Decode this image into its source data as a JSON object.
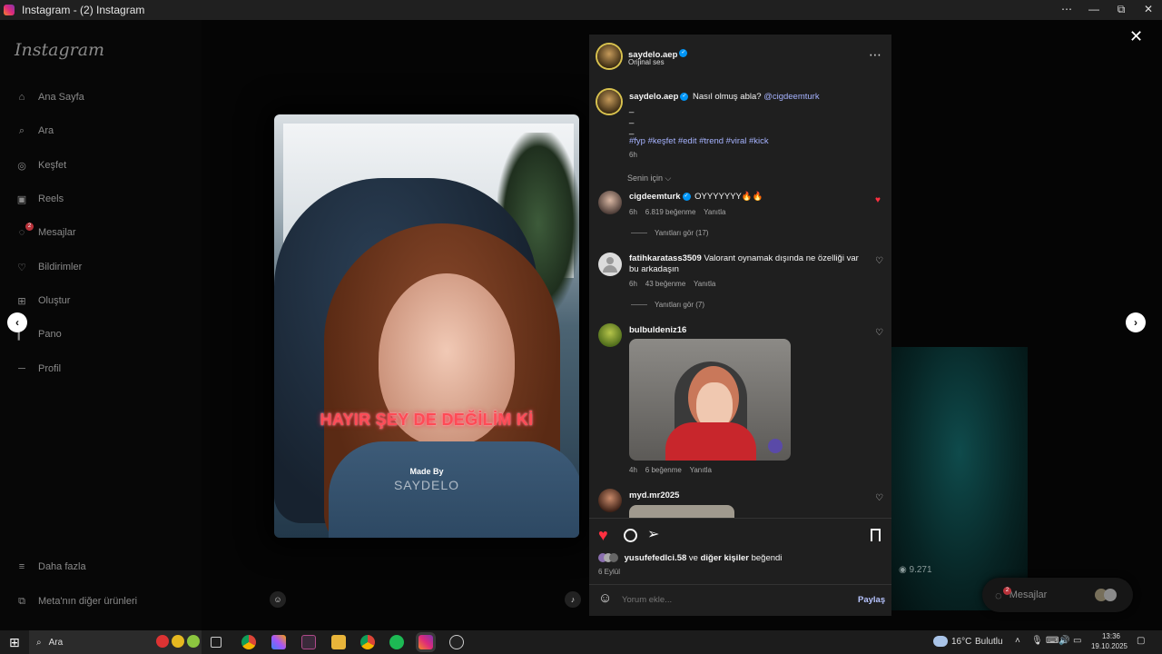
{
  "window": {
    "title": "Instagram - (2) Instagram",
    "min": "—",
    "max": "⧉",
    "close": "✕",
    "more": "⋯"
  },
  "sidebar": {
    "logo": "Instagram",
    "items": [
      {
        "label": "Ana Sayfa",
        "icon": "home-icon",
        "glyph": "⌂"
      },
      {
        "label": "Ara",
        "icon": "search-icon",
        "glyph": "⌕"
      },
      {
        "label": "Keşfet",
        "icon": "compass-icon",
        "glyph": "◎"
      },
      {
        "label": "Reels",
        "icon": "reels-icon",
        "glyph": "▣"
      },
      {
        "label": "Mesajlar",
        "icon": "messenger-icon",
        "glyph": "◌",
        "badge": "2"
      },
      {
        "label": "Bildirimler",
        "icon": "heart-icon",
        "glyph": "♡"
      },
      {
        "label": "Oluştur",
        "icon": "plus-square-icon",
        "glyph": "⊞"
      },
      {
        "label": "Pano",
        "icon": "dashboard-icon",
        "glyph": "▎"
      },
      {
        "label": "Profil",
        "icon": "profile-icon",
        "glyph": "─"
      }
    ],
    "more": {
      "label": "Daha fazla",
      "glyph": "≡"
    },
    "meta": {
      "label": "Meta'nın diğer ürünleri",
      "glyph": "⧉"
    }
  },
  "video": {
    "caption": "HAYIR ŞEY DE DEĞİLİM Kİ",
    "madeby": "Made By",
    "watermark": "SAYDELO",
    "user_icon": "☺",
    "sound_icon": "♪"
  },
  "post": {
    "header": {
      "username": "saydelo.aep",
      "audio": "Orijinal ses",
      "more": "⋯"
    },
    "caption": {
      "username": "saydelo.aep",
      "text": "Nasıl olmuş abla?",
      "mention": "@cigdeemturk",
      "dots": [
        "_",
        "_",
        "_"
      ],
      "hashtags": "#fyp #keşfet #edit #trend #viral #kick",
      "time": "6h"
    },
    "sort": "Senin için ⌵",
    "comments": [
      {
        "username": "cigdeemturk",
        "verified": true,
        "text": "OYYYYYYY🔥🔥",
        "time": "6h",
        "likes": "6.819 beğenme",
        "reply": "Yanıtla",
        "replies": "Yanıtları gör (17)",
        "liked": true
      },
      {
        "username": "fatihkaratass3509",
        "text": "Valorant oynamak dışında ne özelliği var bu arkadaşın",
        "time": "6h",
        "likes": "43 beğenme",
        "reply": "Yanıtla",
        "replies": "Yanıtları gör (7)"
      },
      {
        "username": "bulbuldeniz16",
        "text": "",
        "time": "4h",
        "likes": "6 beğenme",
        "reply": "Yanıtla"
      },
      {
        "username": "myd.mr2025",
        "text": ""
      }
    ],
    "actions": {
      "like": "♥",
      "comment": "◯",
      "share": "➢",
      "save": "☐"
    },
    "liked_by": {
      "user": "yusufefedlci.58",
      "mid": "ve",
      "others": "diğer kişiler",
      "end": "beğendi"
    },
    "date": "6 Eylül",
    "composer": {
      "emoji": "☺",
      "placeholder": "Yorum ekle...",
      "submit": "Paylaş"
    }
  },
  "overlay": {
    "close": "✕",
    "prev": "‹",
    "next": "›",
    "views": "9.271",
    "views_icon": "◉",
    "messages": "Mesajlar",
    "messages_badge": "2"
  },
  "taskbar": {
    "search": "Ara",
    "weather_temp": "16°C",
    "weather_text": "Bulutlu",
    "time": "13:36",
    "date": "19.10.2025",
    "windows_icon": "⊞",
    "chevron": "˄"
  }
}
